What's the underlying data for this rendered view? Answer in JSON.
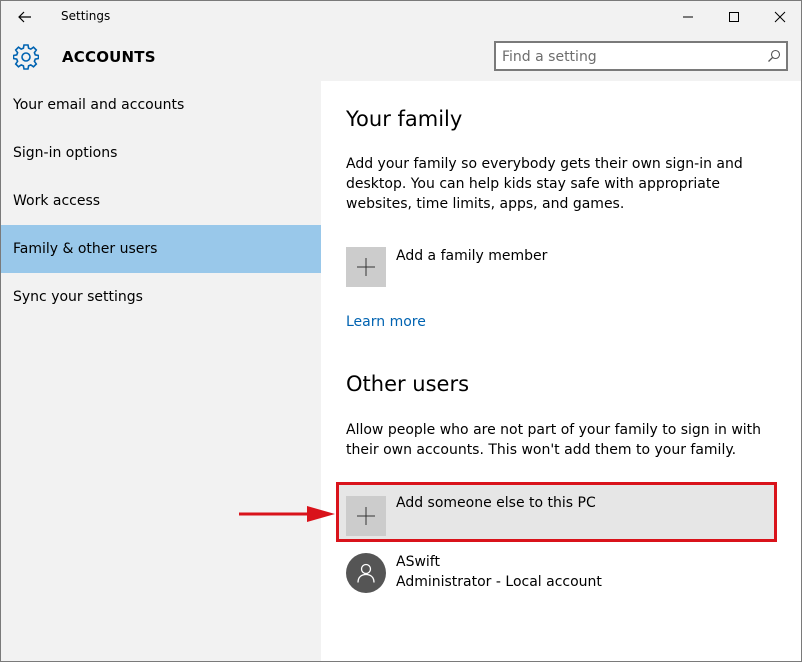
{
  "window": {
    "title": "Settings"
  },
  "header": {
    "section": "ACCOUNTS",
    "search_placeholder": "Find a setting"
  },
  "sidebar": {
    "items": [
      {
        "label": "Your email and accounts",
        "selected": false
      },
      {
        "label": "Sign-in options",
        "selected": false
      },
      {
        "label": "Work access",
        "selected": false
      },
      {
        "label": "Family & other users",
        "selected": true
      },
      {
        "label": "Sync your settings",
        "selected": false
      }
    ]
  },
  "family": {
    "heading": "Your family",
    "description": "Add your family so everybody gets their own sign-in and desktop. You can help kids stay safe with appropriate websites, time limits, apps, and games.",
    "add_label": "Add a family member",
    "learn_more": "Learn more"
  },
  "other_users": {
    "heading": "Other users",
    "description": "Allow people who are not part of your family to sign in with their own accounts. This won't add them to your family.",
    "add_label": "Add someone else to this PC",
    "users": [
      {
        "name": "ASwift",
        "role": "Administrator - Local account"
      }
    ]
  },
  "colors": {
    "selected_nav": "#99c8ea",
    "link": "#0063b1",
    "annotation": "#d9131b"
  },
  "icons": {
    "back": "back-arrow-icon",
    "minimize": "minimize-icon",
    "maximize": "maximize-icon",
    "close": "close-icon",
    "settings": "gear-icon",
    "search": "search-icon",
    "add": "plus-icon",
    "user": "person-icon"
  }
}
